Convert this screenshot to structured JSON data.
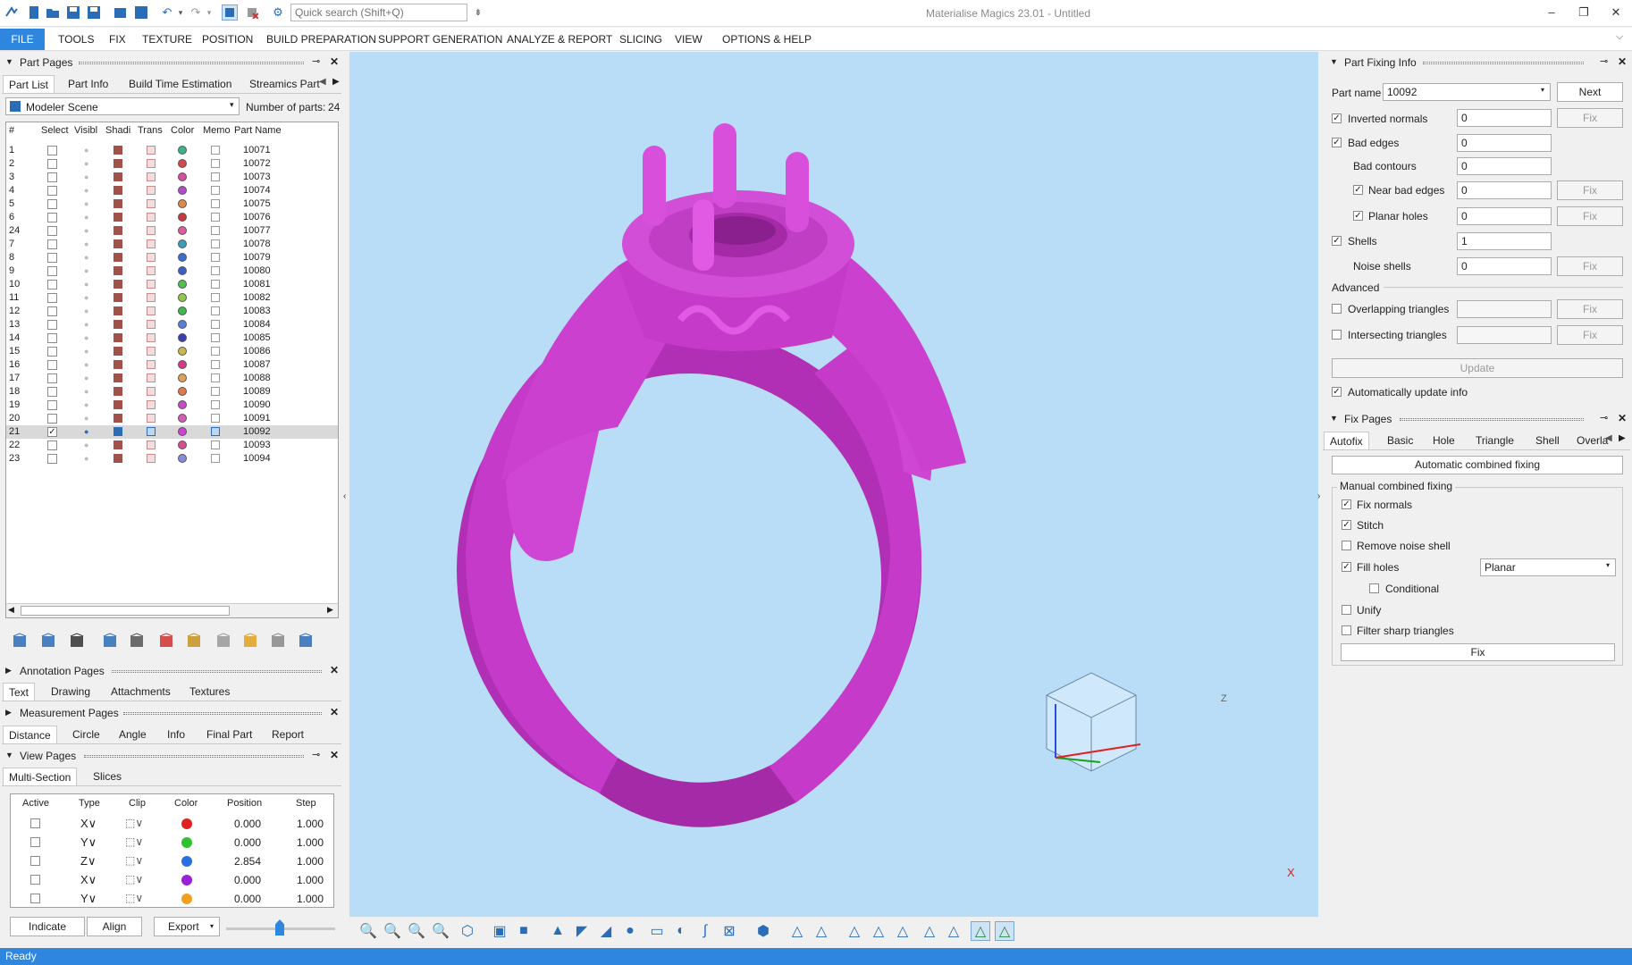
{
  "app": {
    "title": "Materialise Magics 23.01 - Untitled",
    "search_placeholder": "Quick search (Shift+Q)"
  },
  "window": {
    "minimize": "–",
    "restore": "❐",
    "close": "✕"
  },
  "menu": {
    "file": "FILE",
    "items": [
      "TOOLS",
      "FIX",
      "TEXTURE",
      "POSITION",
      "BUILD PREPARATION",
      "SUPPORT GENERATION",
      "ANALYZE & REPORT",
      "SLICING",
      "VIEW",
      "OPTIONS & HELP"
    ]
  },
  "part_pages": {
    "title": "Part Pages",
    "tabs": [
      "Part List",
      "Part Info",
      "Build Time Estimation",
      "Streamics Part"
    ],
    "scene": "Modeler Scene",
    "num_parts_label": "Number of parts:",
    "num_parts": "24",
    "columns": [
      "#",
      "Select",
      "Visibl",
      "Shadi",
      "Trans",
      "Color",
      "Memo",
      "Part Name"
    ],
    "rows": [
      {
        "n": "1",
        "name": "10071",
        "color": "#3bb38a"
      },
      {
        "n": "2",
        "name": "10072",
        "color": "#d24a4a"
      },
      {
        "n": "3",
        "name": "10073",
        "color": "#d84fa0"
      },
      {
        "n": "4",
        "name": "10074",
        "color": "#b44bcf"
      },
      {
        "n": "5",
        "name": "10075",
        "color": "#e0884a"
      },
      {
        "n": "6",
        "name": "10076",
        "color": "#c83a3a"
      },
      {
        "n": "24",
        "name": "10077",
        "color": "#e05aa0"
      },
      {
        "n": "7",
        "name": "10078",
        "color": "#3a9fb5"
      },
      {
        "n": "8",
        "name": "10079",
        "color": "#3a6fd0"
      },
      {
        "n": "9",
        "name": "10080",
        "color": "#3a5fc8"
      },
      {
        "n": "10",
        "name": "10081",
        "color": "#4fc14f"
      },
      {
        "n": "11",
        "name": "10082",
        "color": "#8fc84a"
      },
      {
        "n": "12",
        "name": "10083",
        "color": "#3fb84f"
      },
      {
        "n": "13",
        "name": "10084",
        "color": "#5a7fd8"
      },
      {
        "n": "14",
        "name": "10085",
        "color": "#3a3fb0"
      },
      {
        "n": "15",
        "name": "10086",
        "color": "#c8b84a"
      },
      {
        "n": "16",
        "name": "10087",
        "color": "#d83a8a"
      },
      {
        "n": "17",
        "name": "10088",
        "color": "#e0a05a"
      },
      {
        "n": "18",
        "name": "10089",
        "color": "#e07a4a"
      },
      {
        "n": "19",
        "name": "10090",
        "color": "#c84ac8"
      },
      {
        "n": "20",
        "name": "10091",
        "color": "#d85ab8"
      },
      {
        "n": "21",
        "name": "10092",
        "color": "#d43fd6",
        "selected": true
      },
      {
        "n": "22",
        "name": "10093",
        "color": "#d8508a"
      },
      {
        "n": "23",
        "name": "10094",
        "color": "#8a8ad8"
      }
    ]
  },
  "annotation_pages": {
    "title": "Annotation Pages",
    "tabs": [
      "Text",
      "Drawing",
      "Attachments",
      "Textures"
    ]
  },
  "measurement_pages": {
    "title": "Measurement Pages",
    "tabs": [
      "Distance",
      "Circle",
      "Angle",
      "Info",
      "Final Part",
      "Report"
    ]
  },
  "view_pages": {
    "title": "View Pages",
    "tabs": [
      "Multi-Section",
      "Slices"
    ],
    "columns": [
      "Active",
      "Type",
      "Clip",
      "Color",
      "Position",
      "Step"
    ],
    "rows": [
      {
        "type": "X∨",
        "color": "#e02020",
        "position": "0.000",
        "step": "1.000"
      },
      {
        "type": "Y∨",
        "color": "#30c030",
        "position": "0.000",
        "step": "1.000"
      },
      {
        "type": "Z∨",
        "color": "#2a6fe0",
        "position": "2.854",
        "step": "1.000"
      },
      {
        "type": "X∨",
        "color": "#9a1fd8",
        "position": "0.000",
        "step": "1.000"
      },
      {
        "type": "Y∨",
        "color": "#f0a020",
        "position": "0.000",
        "step": "1.000"
      }
    ],
    "buttons": {
      "indicate": "Indicate",
      "align": "Align",
      "export": "Export"
    }
  },
  "part_fixing_info": {
    "title": "Part Fixing Info",
    "part_name_label": "Part name",
    "part_name": "10092",
    "next": "Next",
    "fix": "Fix",
    "inverted_normals": {
      "label": "Inverted normals",
      "value": "0"
    },
    "bad_edges": {
      "label": "Bad edges",
      "value": "0"
    },
    "bad_contours": {
      "label": "Bad contours",
      "value": "0"
    },
    "near_bad_edges": {
      "label": "Near bad edges",
      "value": "0"
    },
    "planar_holes": {
      "label": "Planar holes",
      "value": "0"
    },
    "shells": {
      "label": "Shells",
      "value": "1"
    },
    "noise_shells": {
      "label": "Noise shells",
      "value": "0"
    },
    "advanced": "Advanced",
    "overlapping": {
      "label": "Overlapping triangles",
      "value": ""
    },
    "intersecting": {
      "label": "Intersecting triangles",
      "value": ""
    },
    "update": "Update",
    "auto_update": "Automatically update info"
  },
  "fix_pages": {
    "title": "Fix Pages",
    "tabs": [
      "Autofix",
      "Basic",
      "Hole",
      "Triangle",
      "Shell",
      "Overla"
    ],
    "auto_combined": "Automatic combined fixing",
    "manual_group": "Manual combined fixing",
    "fix_normals": "Fix normals",
    "stitch": "Stitch",
    "remove_noise": "Remove noise shell",
    "fill_holes": "Fill holes",
    "fill_mode": "Planar",
    "conditional": "Conditional",
    "unify": "Unify",
    "filter_sharp": "Filter sharp triangles",
    "fix_button": "Fix"
  },
  "viewport": {
    "bg": "#b9dcf7",
    "part_color": "#d43fd6",
    "axis_x": "X",
    "axis_z": "Z"
  },
  "status": {
    "text": "Ready"
  }
}
